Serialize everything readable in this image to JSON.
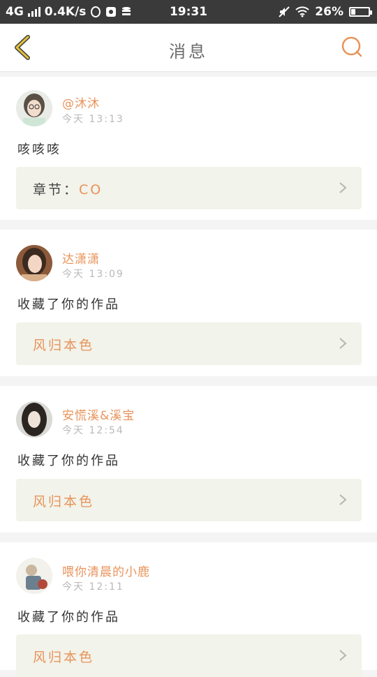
{
  "status_bar": {
    "network": "4G",
    "speed": "0.4K/s",
    "time": "19:31",
    "battery": "26%",
    "battery_level": 0.26
  },
  "nav": {
    "title": "消息",
    "back_icon": "chevron-left-icon",
    "search_icon": "search-icon"
  },
  "colors": {
    "accent": "#e8935a",
    "back_icon": "#e3c03a",
    "link_box_bg": "#f2f3ea"
  },
  "messages": [
    {
      "username": "@沐沐",
      "time": "今天 13:13",
      "text": "咳咳咳",
      "link_prefix": "章节：",
      "link_value": "CO"
    },
    {
      "username": "达潇潇",
      "time": "今天 13:09",
      "text": "收藏了你的作品",
      "link_prefix": "",
      "link_value": "风归本色"
    },
    {
      "username": "安慌溪&溪宝",
      "time": "今天 12:54",
      "text": "收藏了你的作品",
      "link_prefix": "",
      "link_value": "风归本色"
    },
    {
      "username": "喂你清晨的小鹿",
      "time": "今天 12:11",
      "text": "收藏了你的作品",
      "link_prefix": "",
      "link_value": "风归本色"
    }
  ]
}
